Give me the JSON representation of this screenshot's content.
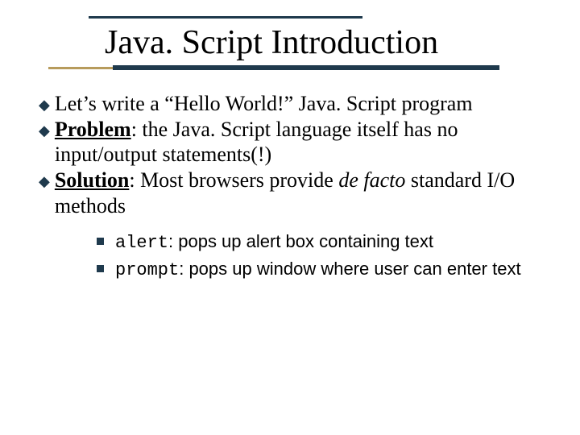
{
  "title": "Java. Script Introduction",
  "bullets": [
    {
      "prefix": "",
      "bold": "",
      "text": "Let’s write a “Hello World!” Java. Script program"
    },
    {
      "prefix": "",
      "bold": "Problem",
      "text": ": the Java. Script language itself has no input/output statements(!)"
    },
    {
      "prefix": "",
      "bold": "Solution",
      "text_before": ": Most browsers provide ",
      "italic": "de facto",
      "text_after": " standard I/O methods"
    }
  ],
  "sub_bullets": [
    {
      "code": "alert",
      "text": ": pops up alert box containing text"
    },
    {
      "code": "prompt",
      "text": ": pops up window where user can enter text"
    }
  ]
}
